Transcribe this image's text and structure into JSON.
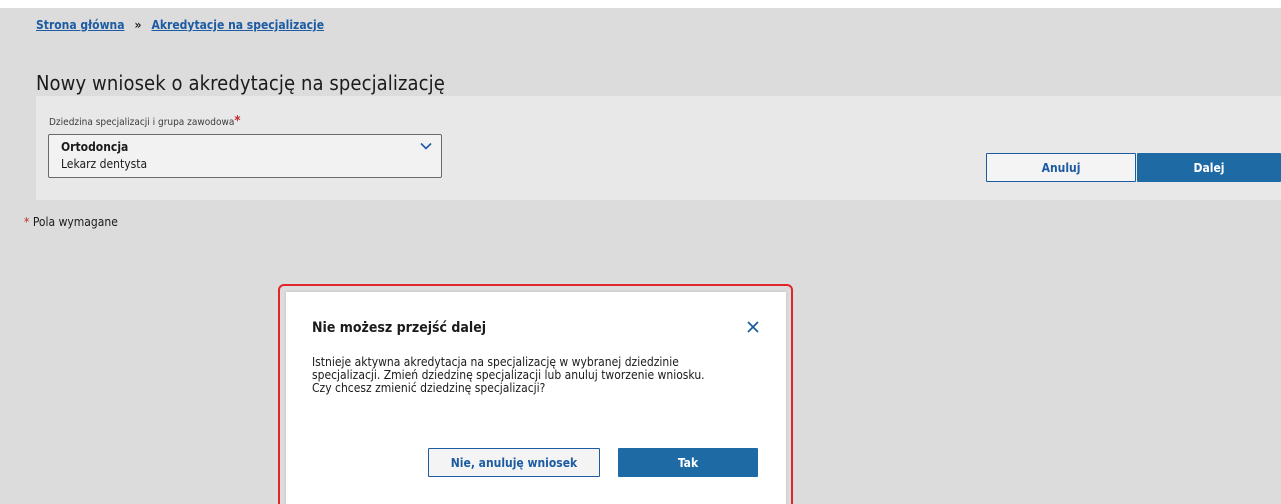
{
  "breadcrumb": {
    "home": "Strona główna",
    "separator": "»",
    "current": "Akredytacje na specjalizacje"
  },
  "page": {
    "title": "Nowy wniosek o akredytację na specjalizację"
  },
  "form": {
    "field_label": "Dziedzina specjalizacji i grupa zawodowa",
    "required_mark": "*",
    "select": {
      "primary": "Ortodoncja",
      "secondary": "Lekarz dentysta",
      "icon": "chevron-down-icon"
    },
    "cancel_label": "Anuluj",
    "next_label": "Dalej"
  },
  "required_note": {
    "mark": "*",
    "text": "Pola wymagane"
  },
  "dialog": {
    "title": "Nie możesz przejść dalej",
    "close_icon": "close-icon",
    "body_lines": [
      "Istnieje aktywna akredytacja na specjalizację w wybranej dziedzinie",
      "specjalizacji. Zmień dziedzinę specjalizacji lub anuluj tworzenie wniosku.",
      "Czy chcesz zmienić dziedzinę specjalizacji?"
    ],
    "cancel_label": "Nie, anuluję wniosek",
    "confirm_label": "Tak"
  },
  "colors": {
    "primary": "#1d6aa5",
    "link": "#1d5ba2",
    "required": "#c0262d",
    "highlight": "#e0252b"
  }
}
